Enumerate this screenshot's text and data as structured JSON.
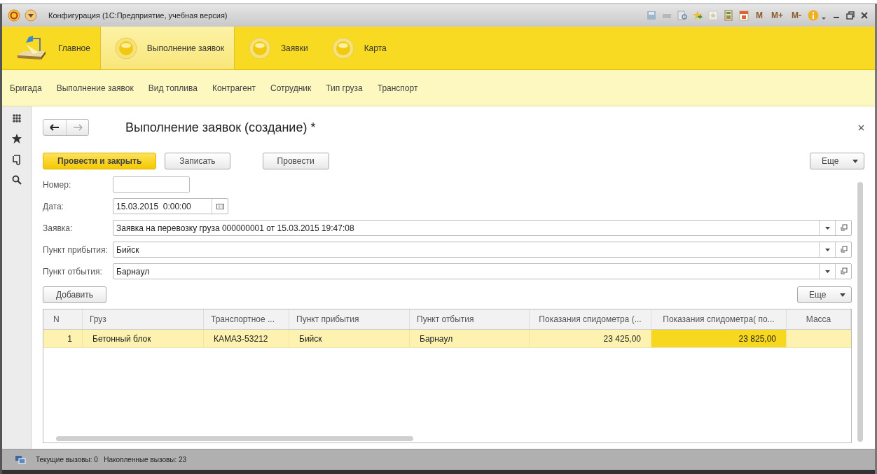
{
  "window": {
    "title": "Конфигурация  (1С:Предприятие, учебная версия)",
    "tools": [
      {
        "kind": "save"
      },
      {
        "kind": "print"
      },
      {
        "kind": "preview"
      },
      {
        "kind": "favorite-add"
      },
      {
        "kind": "favorite"
      },
      {
        "kind": "calculator"
      },
      {
        "kind": "calendar"
      },
      {
        "kind": "text",
        "label": "M"
      },
      {
        "kind": "text",
        "label": "M+"
      },
      {
        "kind": "text",
        "label": "M-"
      },
      {
        "kind": "info"
      }
    ]
  },
  "sections": [
    {
      "label": "Главное",
      "kind": "home",
      "selected": false
    },
    {
      "label": "Выполнение заявок",
      "kind": "orb",
      "selected": true
    },
    {
      "label": "Заявки",
      "kind": "orb",
      "selected": false
    },
    {
      "label": "Карта",
      "kind": "orb",
      "selected": false
    }
  ],
  "subnav": [
    "Бригада",
    "Выполнение заявок",
    "Вид топлива",
    "Контрагент",
    "Сотрудник",
    "Тип груза",
    "Транспорт"
  ],
  "form": {
    "title": "Выполнение заявок (создание) *",
    "buttons": [
      {
        "label": "Провести и закрыть",
        "kind": "primary"
      },
      {
        "label": "Записать",
        "kind": "plain"
      },
      {
        "label": "Провести",
        "kind": "plain"
      }
    ],
    "more": "Еще",
    "fields": [
      {
        "label": "Номер:",
        "kind": "short"
      },
      {
        "label": "Дата:",
        "kind": "date",
        "value": "15.03.2015  0:00:00"
      },
      {
        "label": "Заявка:",
        "kind": "ref",
        "value": "Заявка на перевозку груза 000000001 от 15.03.2015 19:47:08"
      },
      {
        "label": "Пункт прибытия:",
        "kind": "ref",
        "value": "Бийск"
      },
      {
        "label": "Пункт отбытия:",
        "kind": "ref",
        "value": "Барнаул"
      }
    ],
    "table_add": "Добавить",
    "table_more": "Еще",
    "table": {
      "columns": [
        {
          "label": "N",
          "kind": "number"
        },
        {
          "label": "Груз",
          "kind": "text"
        },
        {
          "label": "Транспортное ...",
          "kind": "text"
        },
        {
          "label": "Пункт прибытия",
          "kind": "text"
        },
        {
          "label": "Пункт отбытия",
          "kind": "text"
        },
        {
          "label": "Показания спидометра (...",
          "kind": "number"
        },
        {
          "label": "Показания спидометра( по...",
          "kind": "number"
        },
        {
          "label": "Масса",
          "kind": "number"
        }
      ],
      "rows": [
        {
          "selected": true,
          "cells": [
            {
              "text": "1",
              "current": false
            },
            {
              "text": "Бетонный блок",
              "current": false
            },
            {
              "text": "КАМАЗ-53212",
              "current": false
            },
            {
              "text": "Бийск",
              "current": false
            },
            {
              "text": "Барнаул",
              "current": false
            },
            {
              "text": "23 425,00",
              "current": false
            },
            {
              "text": "23 825,00",
              "current": true
            }
          ]
        }
      ]
    }
  },
  "status_bar": "Текущие вызовы: 0   Накопленные вызовы: 23"
}
